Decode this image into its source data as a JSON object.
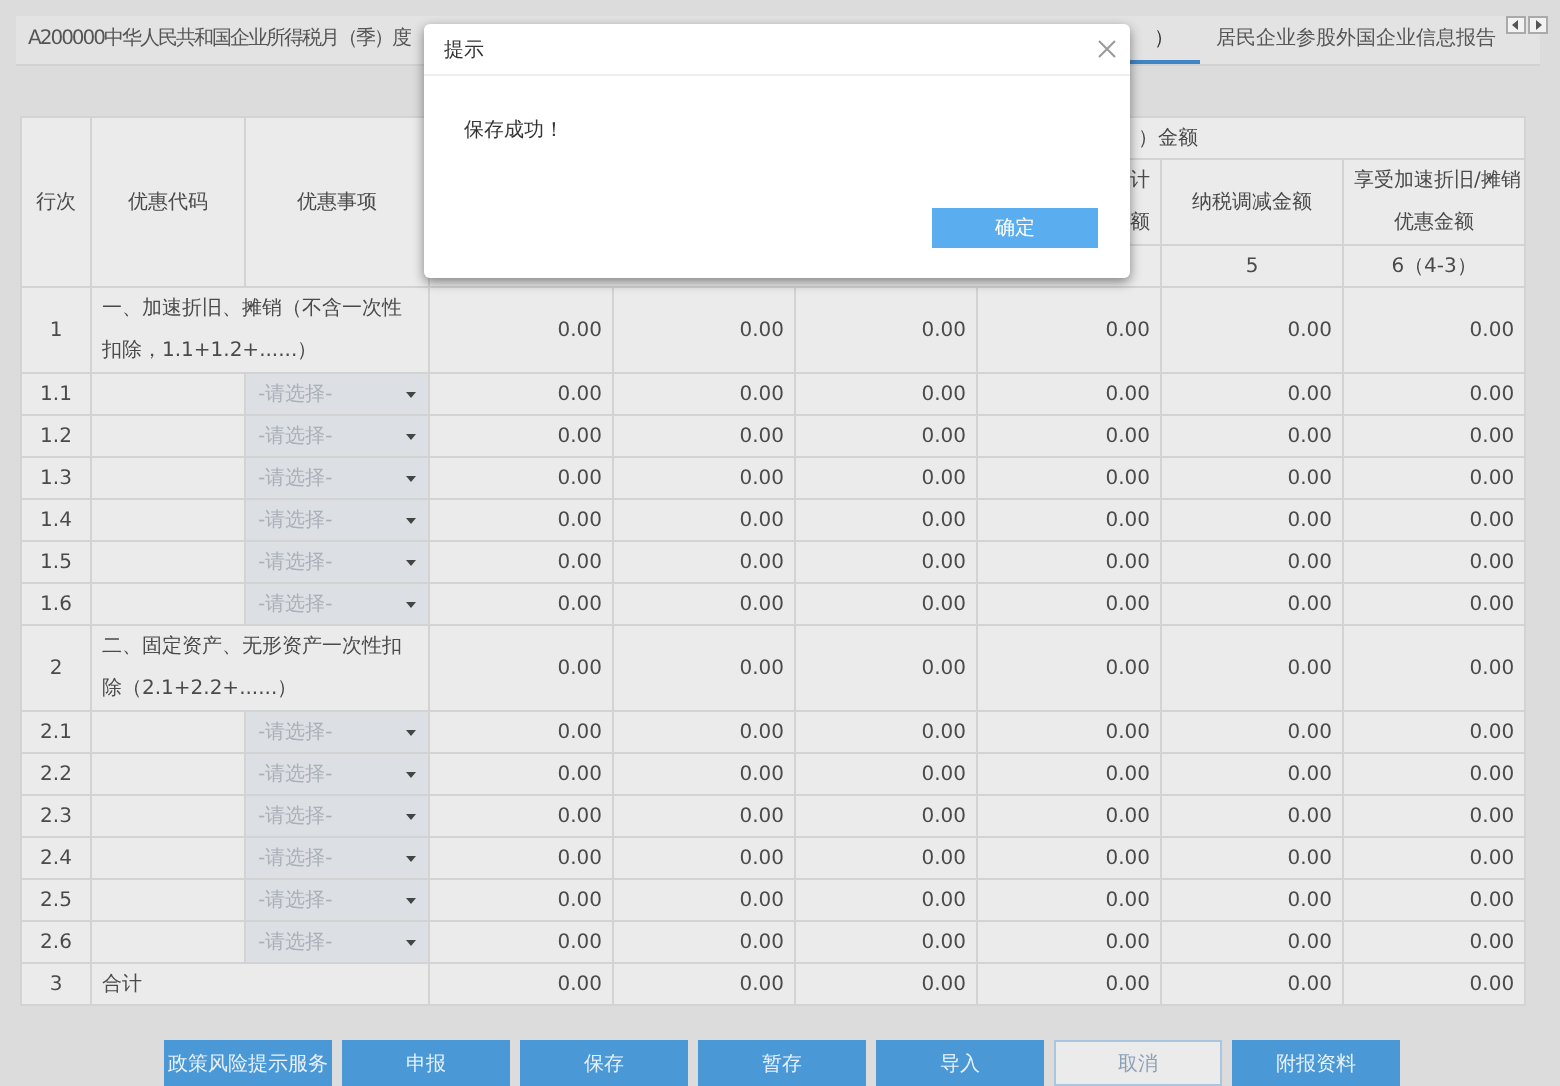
{
  "tabs": [
    {
      "label": "A200000中华人民共和国企业所得税月（季）度",
      "selected": false
    },
    {
      "label": "）",
      "selected": true
    },
    {
      "label": "居民企业参股外国企业信息报告",
      "selected": false
    }
  ],
  "table": {
    "columns": [
      "行次",
      "优惠代码",
      "优惠事项"
    ],
    "group_header": "）金额",
    "header_row2": {
      "column_7": [
        "计",
        "额"
      ],
      "column_8": "纳税调减金额",
      "column_9": [
        "享受加速折旧/摊销",
        "优惠金额"
      ]
    },
    "header_row3": {
      "column_8": "5",
      "column_9": "6（4-3）"
    },
    "rows": [
      {
        "kind": "section",
        "no": "1",
        "label": "一、加速折旧、摊销（不含一次性扣除，1.1+1.2+......）",
        "values": [
          "0.00",
          "0.00",
          "0.00",
          "0.00",
          "0.00",
          "0.00"
        ]
      },
      {
        "kind": "item",
        "no": "1.1",
        "placeholder": "-请选择-",
        "values": [
          "0.00",
          "0.00",
          "0.00",
          "0.00",
          "0.00",
          "0.00"
        ]
      },
      {
        "kind": "item",
        "no": "1.2",
        "placeholder": "-请选择-",
        "values": [
          "0.00",
          "0.00",
          "0.00",
          "0.00",
          "0.00",
          "0.00"
        ]
      },
      {
        "kind": "item",
        "no": "1.3",
        "placeholder": "-请选择-",
        "values": [
          "0.00",
          "0.00",
          "0.00",
          "0.00",
          "0.00",
          "0.00"
        ]
      },
      {
        "kind": "item",
        "no": "1.4",
        "placeholder": "-请选择-",
        "values": [
          "0.00",
          "0.00",
          "0.00",
          "0.00",
          "0.00",
          "0.00"
        ]
      },
      {
        "kind": "item",
        "no": "1.5",
        "placeholder": "-请选择-",
        "values": [
          "0.00",
          "0.00",
          "0.00",
          "0.00",
          "0.00",
          "0.00"
        ]
      },
      {
        "kind": "item",
        "no": "1.6",
        "placeholder": "-请选择-",
        "values": [
          "0.00",
          "0.00",
          "0.00",
          "0.00",
          "0.00",
          "0.00"
        ]
      },
      {
        "kind": "section",
        "no": "2",
        "label": "二、固定资产、无形资产一次性扣除（2.1+2.2+......）",
        "values": [
          "0.00",
          "0.00",
          "0.00",
          "0.00",
          "0.00",
          "0.00"
        ]
      },
      {
        "kind": "item",
        "no": "2.1",
        "placeholder": "-请选择-",
        "values": [
          "0.00",
          "0.00",
          "0.00",
          "0.00",
          "0.00",
          "0.00"
        ]
      },
      {
        "kind": "item",
        "no": "2.2",
        "placeholder": "-请选择-",
        "values": [
          "0.00",
          "0.00",
          "0.00",
          "0.00",
          "0.00",
          "0.00"
        ]
      },
      {
        "kind": "item",
        "no": "2.3",
        "placeholder": "-请选择-",
        "values": [
          "0.00",
          "0.00",
          "0.00",
          "0.00",
          "0.00",
          "0.00"
        ]
      },
      {
        "kind": "item",
        "no": "2.4",
        "placeholder": "-请选择-",
        "values": [
          "0.00",
          "0.00",
          "0.00",
          "0.00",
          "0.00",
          "0.00"
        ]
      },
      {
        "kind": "item",
        "no": "2.5",
        "placeholder": "-请选择-",
        "values": [
          "0.00",
          "0.00",
          "0.00",
          "0.00",
          "0.00",
          "0.00"
        ]
      },
      {
        "kind": "item",
        "no": "2.6",
        "placeholder": "-请选择-",
        "values": [
          "0.00",
          "0.00",
          "0.00",
          "0.00",
          "0.00",
          "0.00"
        ]
      },
      {
        "kind": "total",
        "no": "3",
        "label": "合计",
        "values": [
          "0.00",
          "0.00",
          "0.00",
          "0.00",
          "0.00",
          "0.00"
        ]
      }
    ]
  },
  "buttons": [
    {
      "label": "政策风险提示服务",
      "kind": "primary"
    },
    {
      "label": "申报",
      "kind": "primary"
    },
    {
      "label": "保存",
      "kind": "primary"
    },
    {
      "label": "暂存",
      "kind": "primary"
    },
    {
      "label": "导入",
      "kind": "primary"
    },
    {
      "label": "取消",
      "kind": "outline"
    },
    {
      "label": "附报资料",
      "kind": "primary"
    }
  ],
  "dialog": {
    "title": "提示",
    "message": "保存成功！",
    "button": "确定"
  }
}
